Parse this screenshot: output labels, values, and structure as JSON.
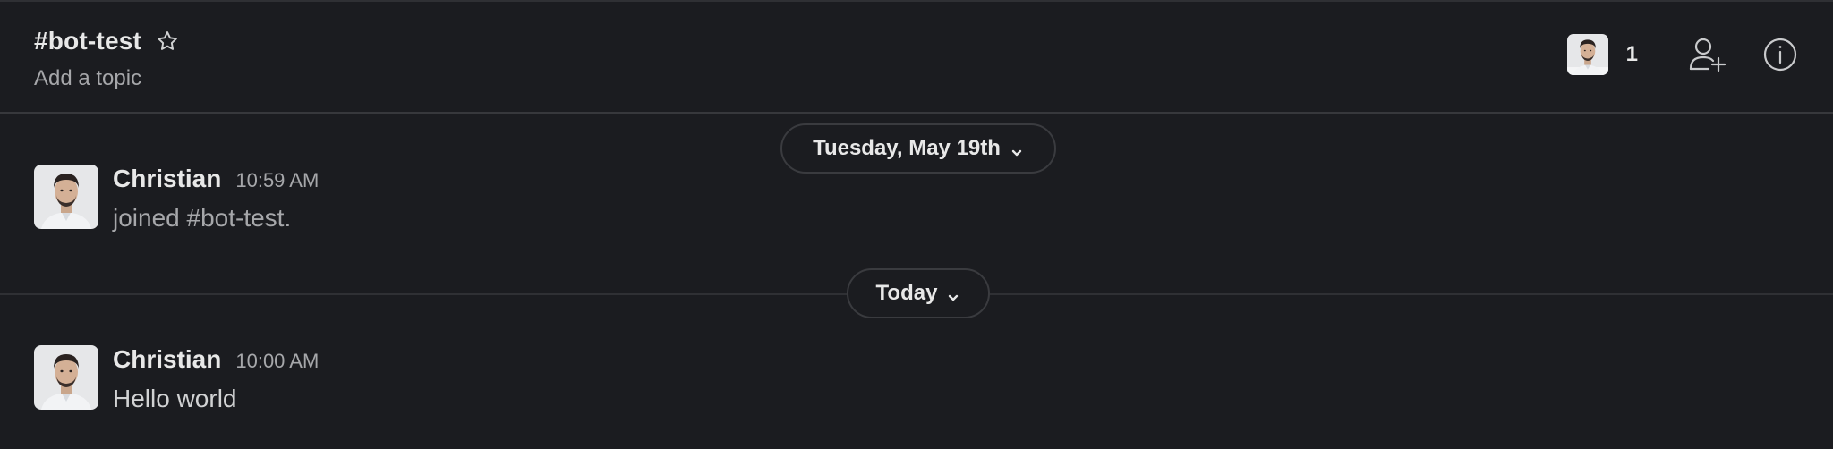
{
  "channel": {
    "name": "#bot-test",
    "topic": "Add a topic",
    "member_count": "1"
  },
  "dividers": [
    {
      "label": "Tuesday, May 19th"
    },
    {
      "label": "Today"
    }
  ],
  "messages": [
    {
      "author": "Christian",
      "time": "10:59 AM",
      "text": "joined #bot-test."
    },
    {
      "author": "Christian",
      "time": "10:00 AM",
      "text": "Hello world"
    }
  ],
  "icons": {
    "star": "star-icon",
    "add_user": "add-user-icon",
    "info": "info-icon",
    "chevron": "chevron-down-icon",
    "avatar": "avatar"
  },
  "colors": {
    "background": "#1b1c20",
    "text_primary": "#e8e8e8",
    "text_secondary": "#a6a7aa",
    "divider": "#2f3034"
  }
}
